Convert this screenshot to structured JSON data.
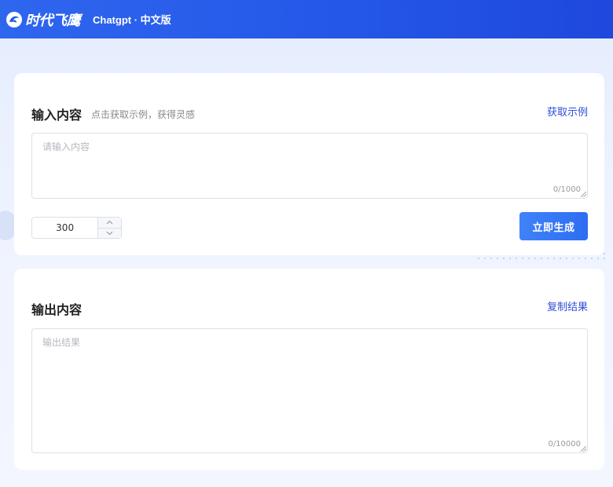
{
  "header": {
    "brand_name": "时代飞鹰",
    "product_label": "Chatgpt · 中文版",
    "logo_icon": "eagle-logo-icon",
    "bg_color": "#2457e8"
  },
  "input_card": {
    "title": "输入内容",
    "hint": "点击获取示例，获得灵感",
    "example_link": "获取示例",
    "textarea_placeholder": "请输入内容",
    "counter": "0/1000",
    "stepper_value": "300",
    "generate_button": "立即生成"
  },
  "output_card": {
    "title": "输出内容",
    "copy_link": "复制结果",
    "textarea_placeholder": "输出结果",
    "counter": "0/10000"
  },
  "colors": {
    "accent": "#2e6df2",
    "link": "#2c4fd8"
  }
}
